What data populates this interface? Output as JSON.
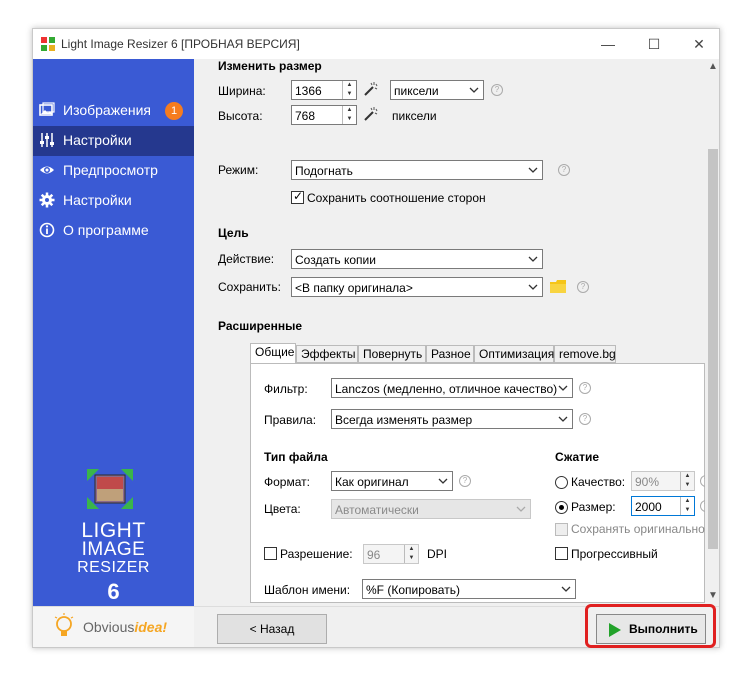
{
  "window": {
    "title": "Light Image Resizer 6  [ПРОБНАЯ ВЕРСИЯ]",
    "minimize_icon": "—",
    "maximize_icon": "☐",
    "close_icon": "✕"
  },
  "sidebar": {
    "items": [
      {
        "label": "Изображения",
        "icon": "images-icon",
        "badge": "1"
      },
      {
        "label": "Настройки",
        "icon": "sliders-icon"
      },
      {
        "label": "Предпросмотр",
        "icon": "eye-icon"
      },
      {
        "label": "Настройки",
        "icon": "gear-icon"
      },
      {
        "label": "О программе",
        "icon": "info-icon"
      }
    ],
    "logo_line1": "LIGHT",
    "logo_line2": "IMAGE",
    "logo_line3": "RESIZER",
    "logo_version": "6",
    "footer_brand_a": "Obvious",
    "footer_brand_b": "idea!"
  },
  "resize": {
    "section_title": "Изменить размер",
    "width_label": "Ширина:",
    "width_value": "1366",
    "height_label": "Высота:",
    "height_value": "768",
    "unit_value": "пиксели",
    "unit_text": "пиксели",
    "mode_label": "Режим:",
    "mode_value": "Подогнать",
    "keep_ratio_label": "Сохранить соотношение сторон",
    "keep_ratio_checked": true
  },
  "target": {
    "section_title": "Цель",
    "action_label": "Действие:",
    "action_value": "Создать копии",
    "save_label": "Сохранить:",
    "save_value": "<В папку оригинала>"
  },
  "advanced": {
    "section_title": "Расширенные",
    "tabs": [
      "Общие",
      "Эффекты",
      "Повернуть",
      "Разное",
      "Оптимизация",
      "remove.bg"
    ],
    "active_tab": "Общие",
    "filter_label": "Фильтр:",
    "filter_value": "Lanczos  (медленно, отличное качество)",
    "rules_label": "Правила:",
    "rules_value": "Всегда изменять размер",
    "filetype_title": "Тип файла",
    "format_label": "Формат:",
    "format_value": "Как оригинал",
    "colors_label": "Цвета:",
    "colors_value": "Автоматически",
    "resolution_label": "Разрешение:",
    "resolution_value": "96",
    "dpi_label": "DPI",
    "template_label": "Шаблон имени:",
    "template_value": "%F (Копировать)",
    "compression_title": "Сжатие",
    "quality_label": "Качество:",
    "quality_value": "90%",
    "size_label": "Размер:",
    "size_value": "2000",
    "keep_original_label": "Сохранять оригинальное ка",
    "progressive_label": "Прогрессивный"
  },
  "footer": {
    "back_label": "< Назад",
    "run_label": "Выполнить"
  },
  "colors": {
    "sidebar": "#3a5ad4",
    "sidebar_active": "#25388e",
    "badge": "#f57c1f",
    "run_play": "#22a22a",
    "highlight": "#e02020"
  }
}
